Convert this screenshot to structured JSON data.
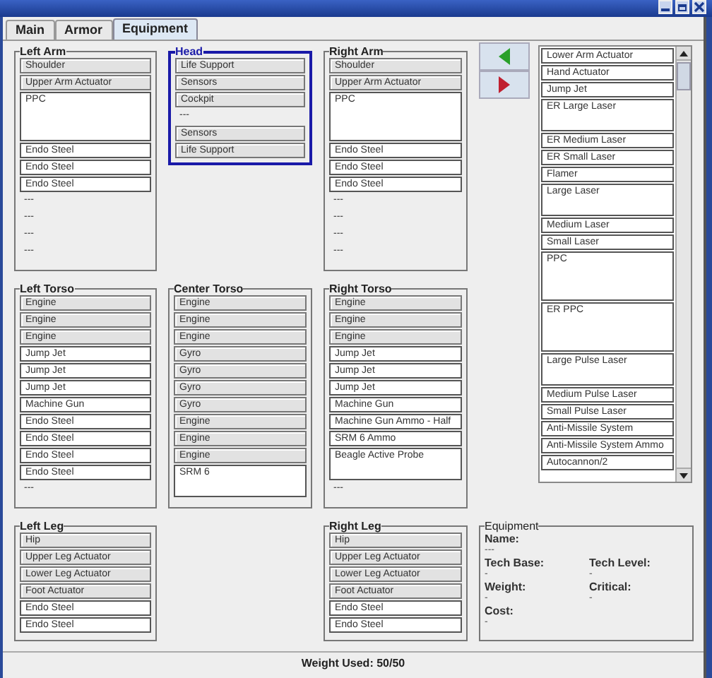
{
  "tabs": [
    {
      "label": "Main",
      "selected": false
    },
    {
      "label": "Armor",
      "selected": false
    },
    {
      "label": "Equipment",
      "selected": true
    }
  ],
  "locations": [
    {
      "title": "Left Arm",
      "selected": false,
      "slots": [
        {
          "kind": "fixed",
          "label": "Shoulder"
        },
        {
          "kind": "fixed",
          "label": "Upper Arm Actuator"
        },
        {
          "kind": "item-taller",
          "label": "PPC"
        },
        {
          "kind": "item",
          "label": "Endo Steel"
        },
        {
          "kind": "item",
          "label": "Endo Steel"
        },
        {
          "kind": "item",
          "label": "Endo Steel"
        },
        {
          "kind": "empty",
          "label": "---"
        },
        {
          "kind": "empty",
          "label": "---"
        },
        {
          "kind": "empty",
          "label": "---"
        },
        {
          "kind": "empty",
          "label": "---"
        }
      ]
    },
    {
      "title": "Head",
      "selected": true,
      "slots": [
        {
          "kind": "fixed",
          "label": "Life Support"
        },
        {
          "kind": "fixed",
          "label": "Sensors"
        },
        {
          "kind": "fixed",
          "label": "Cockpit"
        },
        {
          "kind": "empty",
          "label": "---"
        },
        {
          "kind": "fixed",
          "label": "Sensors"
        },
        {
          "kind": "fixed",
          "label": "Life Support"
        }
      ]
    },
    {
      "title": "Right Arm",
      "selected": false,
      "slots": [
        {
          "kind": "fixed",
          "label": "Shoulder"
        },
        {
          "kind": "fixed",
          "label": "Upper Arm Actuator"
        },
        {
          "kind": "item-taller",
          "label": "PPC"
        },
        {
          "kind": "item",
          "label": "Endo Steel"
        },
        {
          "kind": "item",
          "label": "Endo Steel"
        },
        {
          "kind": "item",
          "label": "Endo Steel"
        },
        {
          "kind": "empty",
          "label": "---"
        },
        {
          "kind": "empty",
          "label": "---"
        },
        {
          "kind": "empty",
          "label": "---"
        },
        {
          "kind": "empty",
          "label": "---"
        }
      ]
    },
    {
      "title": "Left Torso",
      "selected": false,
      "slots": [
        {
          "kind": "fixed",
          "label": "Engine"
        },
        {
          "kind": "fixed",
          "label": "Engine"
        },
        {
          "kind": "fixed",
          "label": "Engine"
        },
        {
          "kind": "item",
          "label": "Jump Jet"
        },
        {
          "kind": "item",
          "label": "Jump Jet"
        },
        {
          "kind": "item",
          "label": "Jump Jet"
        },
        {
          "kind": "item",
          "label": "Machine Gun"
        },
        {
          "kind": "item",
          "label": "Endo Steel"
        },
        {
          "kind": "item",
          "label": "Endo Steel"
        },
        {
          "kind": "item",
          "label": "Endo Steel"
        },
        {
          "kind": "item",
          "label": "Endo Steel"
        },
        {
          "kind": "empty",
          "label": "---"
        }
      ]
    },
    {
      "title": "Center Torso",
      "selected": false,
      "slots": [
        {
          "kind": "fixed",
          "label": "Engine"
        },
        {
          "kind": "fixed",
          "label": "Engine"
        },
        {
          "kind": "fixed",
          "label": "Engine"
        },
        {
          "kind": "fixed",
          "label": "Gyro"
        },
        {
          "kind": "fixed",
          "label": "Gyro"
        },
        {
          "kind": "fixed",
          "label": "Gyro"
        },
        {
          "kind": "fixed",
          "label": "Gyro"
        },
        {
          "kind": "fixed",
          "label": "Engine"
        },
        {
          "kind": "fixed",
          "label": "Engine"
        },
        {
          "kind": "fixed",
          "label": "Engine"
        },
        {
          "kind": "item-tall",
          "label": "SRM 6"
        }
      ]
    },
    {
      "title": "Right Torso",
      "selected": false,
      "slots": [
        {
          "kind": "fixed",
          "label": "Engine"
        },
        {
          "kind": "fixed",
          "label": "Engine"
        },
        {
          "kind": "fixed",
          "label": "Engine"
        },
        {
          "kind": "item",
          "label": "Jump Jet"
        },
        {
          "kind": "item",
          "label": "Jump Jet"
        },
        {
          "kind": "item",
          "label": "Jump Jet"
        },
        {
          "kind": "item",
          "label": "Machine Gun"
        },
        {
          "kind": "item",
          "label": "Machine Gun Ammo - Half"
        },
        {
          "kind": "item",
          "label": "SRM 6 Ammo"
        },
        {
          "kind": "item-tall",
          "label": "Beagle Active Probe"
        },
        {
          "kind": "empty",
          "label": "---"
        }
      ]
    },
    {
      "title": "Left Leg",
      "selected": false,
      "slots": [
        {
          "kind": "fixed",
          "label": "Hip"
        },
        {
          "kind": "fixed",
          "label": "Upper Leg Actuator"
        },
        {
          "kind": "fixed",
          "label": "Lower Leg Actuator"
        },
        {
          "kind": "fixed",
          "label": "Foot Actuator"
        },
        {
          "kind": "item",
          "label": "Endo Steel"
        },
        {
          "kind": "item",
          "label": "Endo Steel"
        }
      ]
    },
    {
      "title": "Right Leg",
      "selected": false,
      "slots": [
        {
          "kind": "fixed",
          "label": "Hip"
        },
        {
          "kind": "fixed",
          "label": "Upper Leg Actuator"
        },
        {
          "kind": "fixed",
          "label": "Lower Leg Actuator"
        },
        {
          "kind": "fixed",
          "label": "Foot Actuator"
        },
        {
          "kind": "item",
          "label": "Endo Steel"
        },
        {
          "kind": "item",
          "label": "Endo Steel"
        }
      ]
    }
  ],
  "equipment_list": [
    {
      "kind": "item",
      "label": "Lower Arm Actuator"
    },
    {
      "kind": "item",
      "label": "Hand Actuator"
    },
    {
      "kind": "item",
      "label": "Jump Jet"
    },
    {
      "kind": "item-tall",
      "label": "ER Large Laser"
    },
    {
      "kind": "item",
      "label": "ER Medium Laser"
    },
    {
      "kind": "item",
      "label": "ER Small Laser"
    },
    {
      "kind": "item",
      "label": "Flamer"
    },
    {
      "kind": "item-tall",
      "label": "Large Laser"
    },
    {
      "kind": "item",
      "label": "Medium Laser"
    },
    {
      "kind": "item",
      "label": "Small Laser"
    },
    {
      "kind": "item-taller",
      "label": "PPC"
    },
    {
      "kind": "item-taller",
      "label": "ER PPC"
    },
    {
      "kind": "item-tall",
      "label": "Large Pulse Laser"
    },
    {
      "kind": "item",
      "label": "Medium Pulse Laser"
    },
    {
      "kind": "item",
      "label": "Small Pulse Laser"
    },
    {
      "kind": "item",
      "label": "Anti-Missile System"
    },
    {
      "kind": "item",
      "label": "Anti-Missile System Ammo"
    },
    {
      "kind": "item",
      "label": "Autocannon/2"
    }
  ],
  "equipment_info": {
    "title": "Equipment",
    "fields": [
      {
        "label": "Name:",
        "value": "---"
      },
      {
        "label": "Tech Base:",
        "value": "-"
      },
      {
        "label": "Tech Level:",
        "value": "-"
      },
      {
        "label": "Weight:",
        "value": "-"
      },
      {
        "label": "Critical:",
        "value": "-"
      },
      {
        "label": "Cost:",
        "value": "-"
      }
    ]
  },
  "status_bar": "Weight Used: 50/50"
}
